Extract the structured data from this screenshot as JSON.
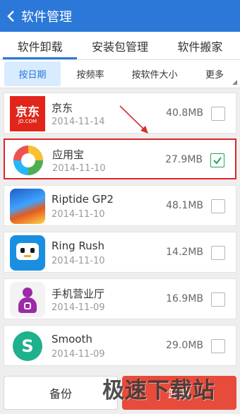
{
  "header": {
    "title": "软件管理"
  },
  "tabs": [
    {
      "label": "软件卸载",
      "active": true
    },
    {
      "label": "安装包管理",
      "active": false
    },
    {
      "label": "软件搬家",
      "active": false
    }
  ],
  "subtabs": [
    {
      "label": "按日期",
      "active": true
    },
    {
      "label": "按频率",
      "active": false
    },
    {
      "label": "按软件大小",
      "active": false
    },
    {
      "label": "更多",
      "active": false
    }
  ],
  "apps": [
    {
      "name": "京东",
      "date": "2014-11-14",
      "size": "40.8MB",
      "checked": false,
      "icon": "jd-logo",
      "icon_text_main": "京东",
      "icon_text_sub": "JD.COM"
    },
    {
      "name": "应用宝",
      "date": "2014-11-10",
      "size": "27.9MB",
      "checked": true,
      "icon": "yingyongbao-logo"
    },
    {
      "name": "Riptide GP2",
      "date": "2014-11-10",
      "size": "48.1MB",
      "checked": false,
      "icon": "riptide-game-icon"
    },
    {
      "name": "Ring Rush",
      "date": "2014-11-10",
      "size": "14.2MB",
      "checked": false,
      "icon": "ring-rush-robot-icon"
    },
    {
      "name": "手机营业厅",
      "date": "2014-11-09",
      "size": "16.9MB",
      "checked": false,
      "icon": "unicom-person-icon"
    },
    {
      "name": "Smooth",
      "date": "2014-11-09",
      "size": "29.0MB",
      "checked": false,
      "icon": "smooth-s-icon",
      "icon_letter": "S"
    }
  ],
  "bottom": {
    "backup_label": "备份",
    "uninstall_label": "卸载"
  },
  "watermark": "极速下载站",
  "colors": {
    "accent": "#2b78d8",
    "danger": "#e64b3b",
    "check": "#27a060",
    "highlight": "#e02424"
  }
}
